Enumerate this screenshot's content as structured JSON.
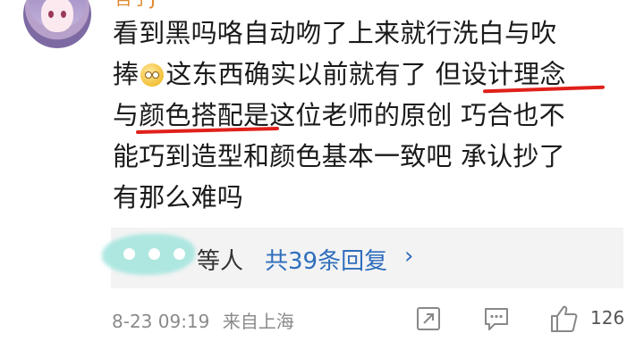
{
  "user": {
    "name": "吾子J·"
  },
  "comment": {
    "lines": [
      "看到黑吗咯自动吻了上来就行洗白与吹",
      "捧",
      "这东西确实以前就有了 但设计理念",
      "与颜色搭配是这位老师的原创 巧合也不",
      "能巧到造型和颜色基本一致吧 承认抄了",
      "有那么难吗"
    ]
  },
  "replies": {
    "suffix": "等人",
    "link": "共39条回复",
    "chevron": "›"
  },
  "meta": {
    "timestamp": "8-23 09:19",
    "location": "来自上海",
    "likes": "126"
  },
  "icons": {
    "share": "share-icon",
    "comment": "comment-icon",
    "like": "thumbs-up-icon"
  },
  "colors": {
    "link": "#2f6ebd",
    "underline": "#e0201a",
    "username": "#e08a2e"
  }
}
